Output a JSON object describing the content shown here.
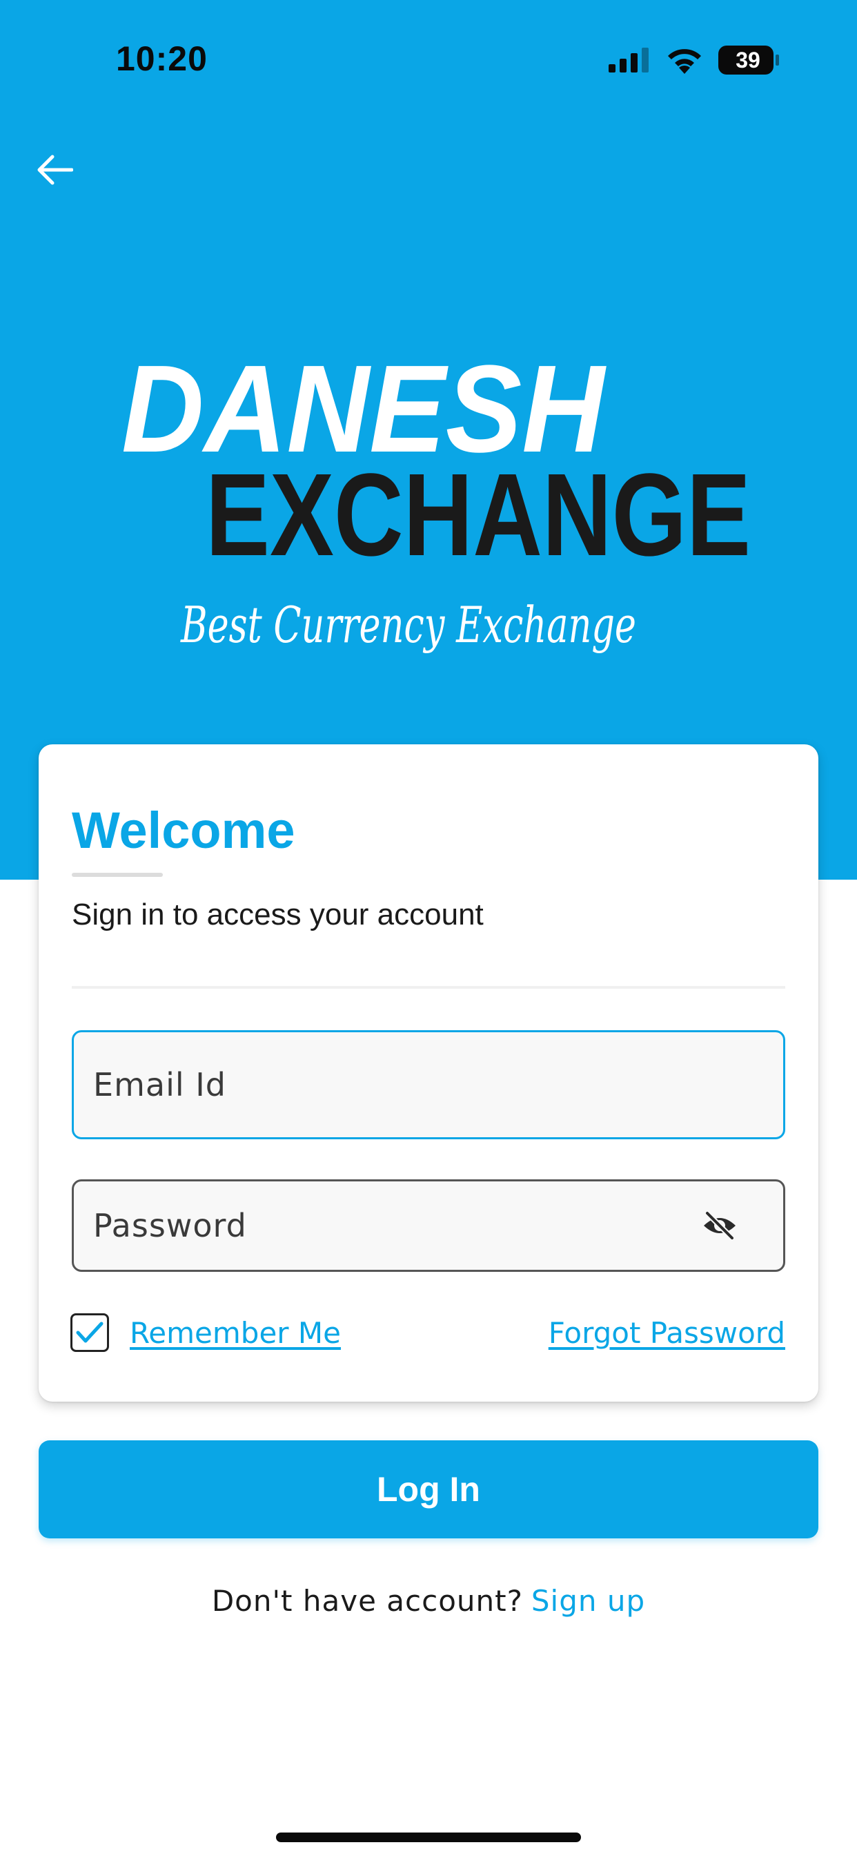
{
  "colors": {
    "brand_blue": "#0aa6e6",
    "logo_dark": "#1a1a1a",
    "background": "#ffffff"
  },
  "status_bar": {
    "time": "10:20",
    "battery_level": "39",
    "icons": [
      "signal-icon",
      "wifi-icon",
      "battery-icon"
    ]
  },
  "header": {
    "back_icon": "arrow-left-icon"
  },
  "logo": {
    "line1": "DANESH",
    "line2": "EXCHANGE",
    "tagline": "Best Currency Exchange"
  },
  "login_card": {
    "title": "Welcome",
    "subtitle": "Sign in to access your account",
    "email_placeholder": "Email Id",
    "password_placeholder": "Password",
    "password_toggle_icon": "eye-slash-icon",
    "remember_me_label": "Remember Me",
    "remember_me_checked": true,
    "forgot_password_label": "Forgot Password"
  },
  "actions": {
    "login_label": "Log In",
    "signup_prompt": "Don't have account?",
    "signup_label": "Sign up"
  }
}
